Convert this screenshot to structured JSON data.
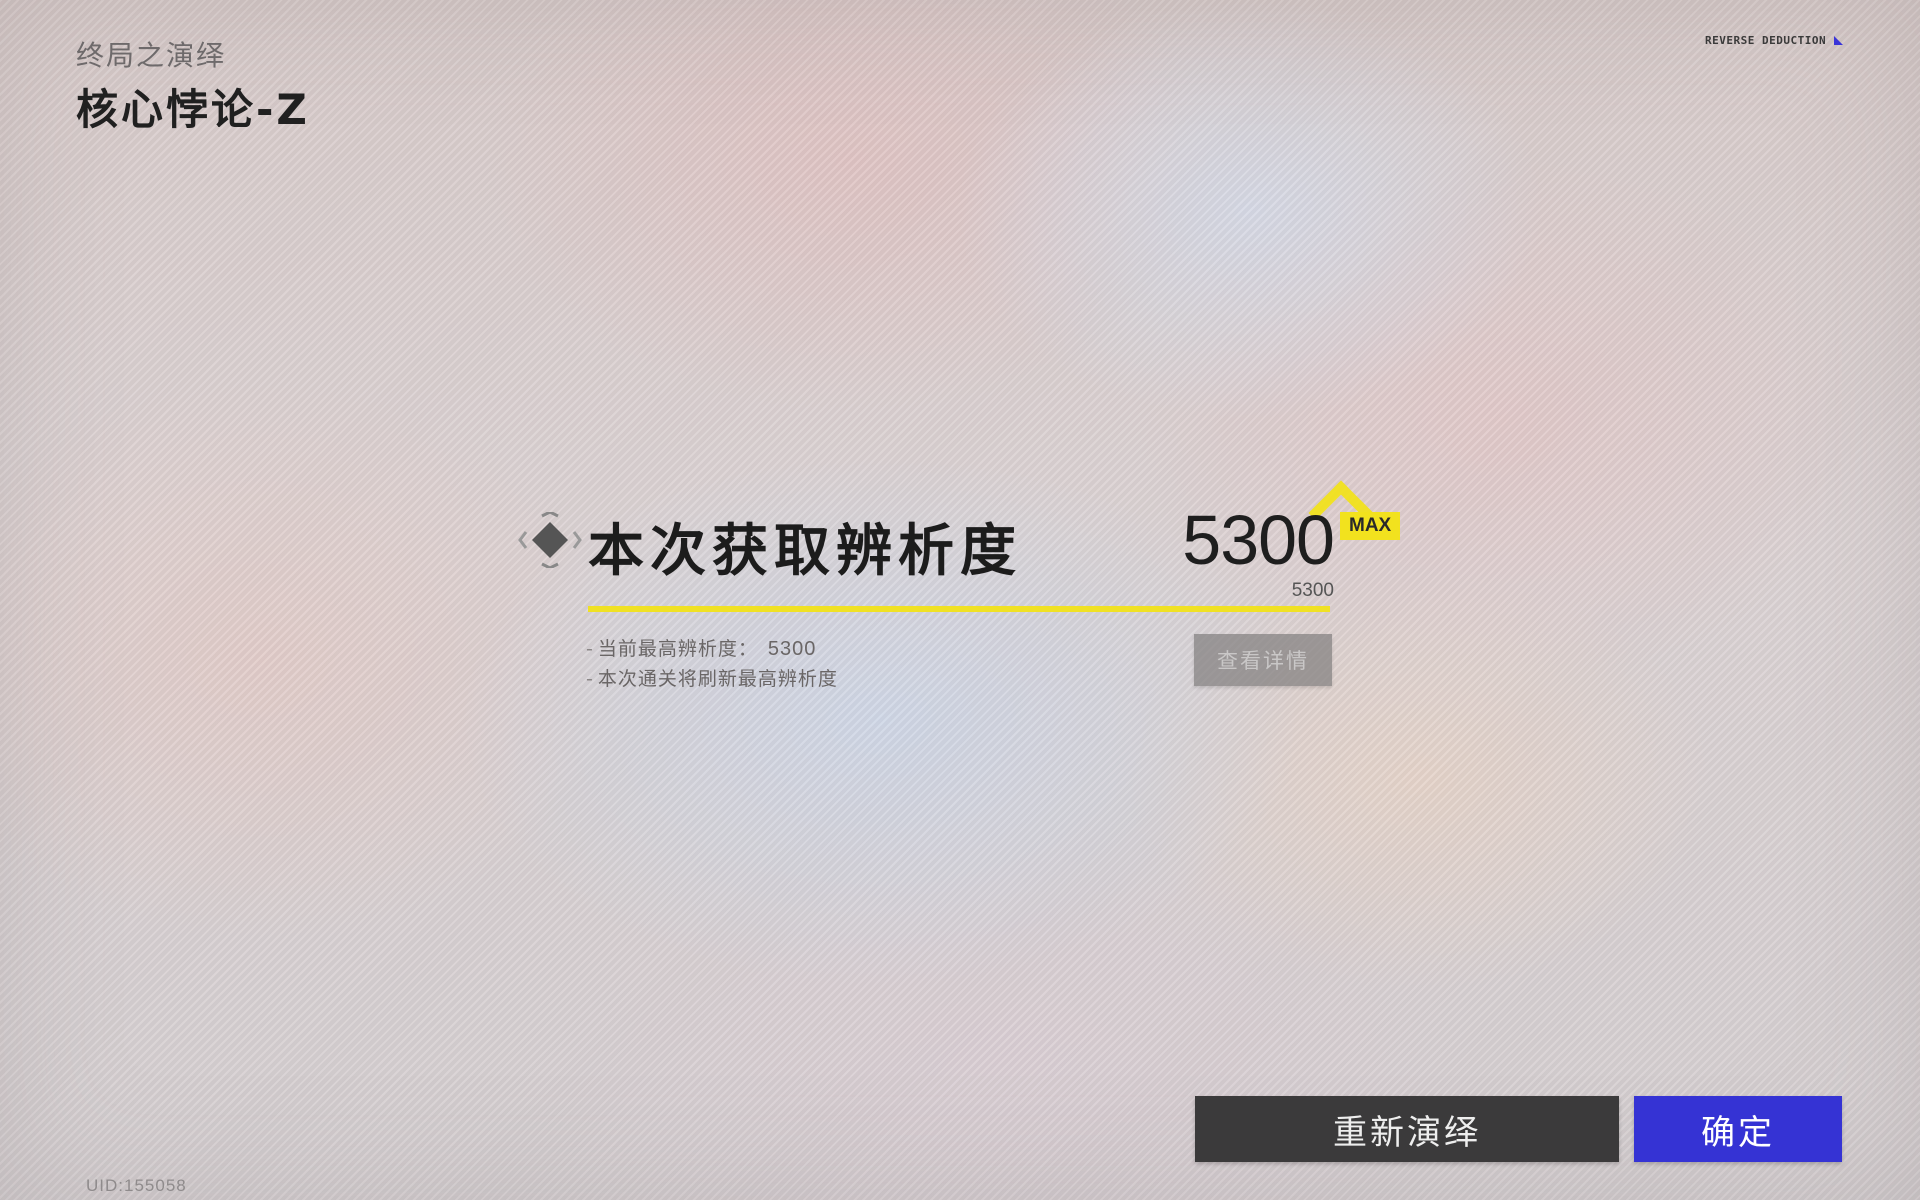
{
  "header": {
    "subtitle": "终局之演绎",
    "title": "核心悖论-Z",
    "brand": "REVERSE DEDUCTION"
  },
  "result": {
    "section_title": "本次获取辨析度",
    "score": "5300",
    "max_badge": "MAX",
    "score_max": "5300",
    "progress_fraction": 1.0,
    "notes": [
      {
        "label": "当前最高辨析度：",
        "value": "5300"
      },
      {
        "label": "本次通关将刷新最高辨析度",
        "value": ""
      }
    ],
    "details_button": "查看详情",
    "colors": {
      "progress": "#f0e124",
      "badge": "#f2e21e"
    }
  },
  "actions": {
    "retry_label": "重新演绎",
    "confirm_label": "确定",
    "confirm_color": "#3533d4"
  },
  "footer": {
    "uid": "UID:155058"
  },
  "icons": {
    "section_icon": "diamond-target-icon",
    "brand_icon": "corner-triangle-icon"
  }
}
